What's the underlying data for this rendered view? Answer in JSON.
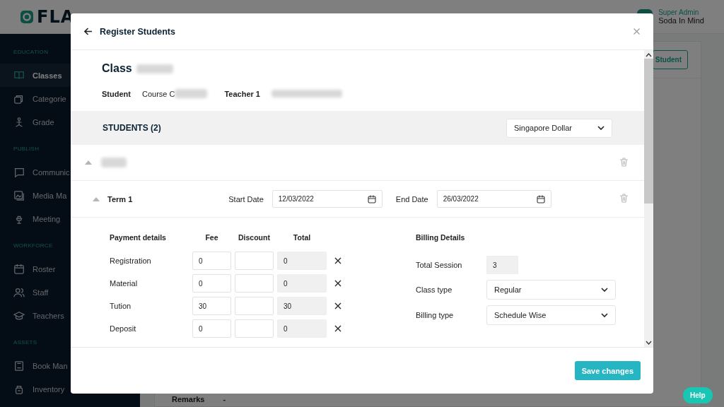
{
  "app": {
    "logo": "FLA",
    "user_role": "Super Admin",
    "user_name": "Soda In Mind",
    "background_button": "Student",
    "background_label": "Remarks",
    "background_value": "-",
    "help": "Help"
  },
  "sidebar": {
    "sections": [
      {
        "title": "EDUCATION",
        "items": [
          {
            "label": "Classes",
            "selected": true
          },
          {
            "label": "Categorie",
            "selected": false
          },
          {
            "label": "Grade",
            "selected": false
          }
        ]
      },
      {
        "title": "PUBLISH",
        "items": [
          {
            "label": "Communic",
            "selected": false
          },
          {
            "label": "Media Ma",
            "selected": false
          },
          {
            "label": "Meeting",
            "selected": false
          }
        ]
      },
      {
        "title": "WORKFORCE",
        "items": [
          {
            "label": "Roster",
            "selected": false
          },
          {
            "label": "Staff",
            "selected": false
          },
          {
            "label": "Teachers",
            "selected": false
          }
        ]
      },
      {
        "title": "ASSETS",
        "items": [
          {
            "label": "Book Man",
            "selected": false
          },
          {
            "label": "Inventory",
            "selected": false
          }
        ]
      }
    ]
  },
  "modal": {
    "title": "Register Students",
    "class_label": "Class",
    "student_label": "Student",
    "student_value": "Course C",
    "teacher_label": "Teacher 1",
    "students_heading": "STUDENTS (2)",
    "currency": "Singapore Dollar",
    "student_expanded": true,
    "term": {
      "name": "Term 1",
      "expanded": true,
      "start_label": "Start Date",
      "start_date": "12/03/2022",
      "end_label": "End Date",
      "end_date": "26/03/2022"
    },
    "payment": {
      "columns": [
        "Payment details",
        "Fee",
        "Discount",
        "Total"
      ],
      "rows": [
        {
          "name": "Registration",
          "fee": "0",
          "total": "0"
        },
        {
          "name": "Material",
          "fee": "0",
          "total": "0"
        },
        {
          "name": "Tution",
          "fee": "30",
          "total": "30"
        },
        {
          "name": "Deposit",
          "fee": "0",
          "total": "0"
        }
      ]
    },
    "billing": {
      "title": "Billing Details",
      "total_session_label": "Total Session",
      "total_session": "3",
      "class_type_label": "Class type",
      "class_type": "Regular",
      "billing_type_label": "Billing type",
      "billing_type": "Schedule Wise"
    },
    "save": "Save changes"
  }
}
